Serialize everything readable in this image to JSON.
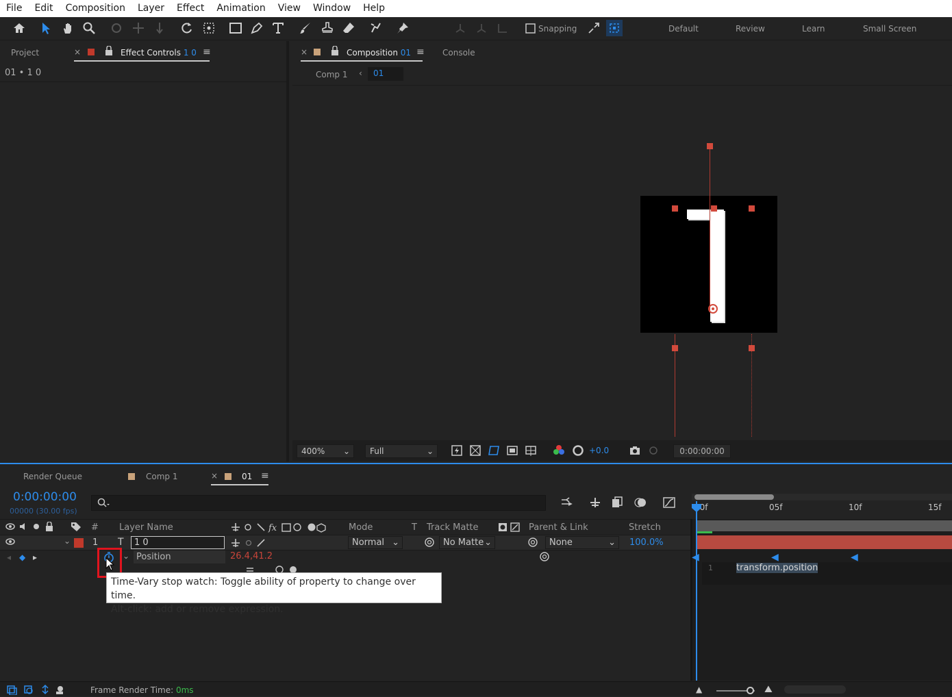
{
  "menu": [
    "File",
    "Edit",
    "Composition",
    "Layer",
    "Effect",
    "Animation",
    "View",
    "Window",
    "Help"
  ],
  "toolbar": {
    "snapping_label": "Snapping"
  },
  "workspaces": [
    "Default",
    "Review",
    "Learn",
    "Small Screen"
  ],
  "left_panel": {
    "tab_project": "Project",
    "tab_effect_controls": "Effect Controls",
    "effect_controls_layer": "1 0",
    "breadcrumb": "01 • 1 0"
  },
  "comp_panel": {
    "tab_composition": "Composition",
    "composition_name": "01",
    "tab_console": "Console",
    "crumb_comp1": "Comp 1",
    "crumb_01": "01",
    "zoom": "400%",
    "resolution": "Full",
    "exposure": "+0.0",
    "timecode": "0:00:00:00"
  },
  "timeline": {
    "tab_render_queue": "Render Queue",
    "tab_comp1": "Comp 1",
    "tab_01": "01",
    "current_time": "0:00:00:00",
    "frame_info": "00000 (30.00 fps)",
    "search_placeholder": "",
    "columns": {
      "num": "#",
      "layer_name": "Layer Name",
      "mode": "Mode",
      "t": "T",
      "track_matte": "Track Matte",
      "parent": "Parent & Link",
      "stretch": "Stretch"
    },
    "layer": {
      "num": "1",
      "name": "1 0",
      "mode": "Normal",
      "matte": "No Matte",
      "parent": "None",
      "stretch": "100.0%"
    },
    "property": {
      "name": "Position",
      "value": "26.4,41.2"
    },
    "ruler": [
      "00f",
      "05f",
      "10f",
      "15f"
    ],
    "expression_line": "1",
    "expression_text": "transform.position",
    "frame_render_label": "Frame Render Time:",
    "frame_render_value": "0ms"
  },
  "tooltip": {
    "line1": "Time-Vary stop watch: Toggle ability of property to change over time.",
    "line2": "Alt-click: add or remove expression."
  },
  "colors": {
    "accent": "#2d8ceb",
    "layer_label": "#c0392b",
    "handle": "#d24a3c",
    "highlight_box": "#e0141e"
  }
}
